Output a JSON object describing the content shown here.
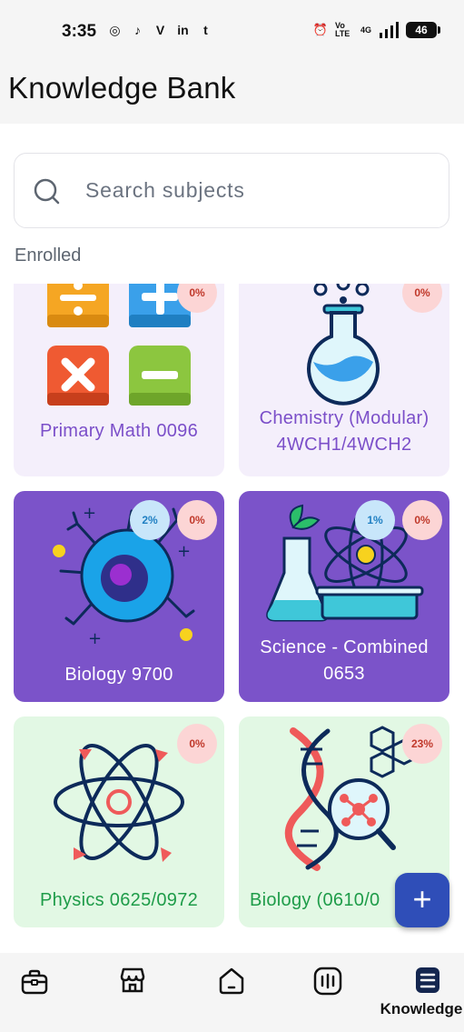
{
  "status_bar": {
    "time": "3:35",
    "app_icons": [
      "instagram-icon",
      "tiktok-icon",
      "v-icon",
      "linkedin-icon",
      "tumblr-icon"
    ],
    "app_glyphs": [
      "◎",
      "♪",
      "V",
      "in",
      "t"
    ],
    "network": "Vo LTE",
    "signal": "4G",
    "battery": "46"
  },
  "header": {
    "title": "Knowledge Bank"
  },
  "search": {
    "placeholder": "Search subjects",
    "value": ""
  },
  "section": {
    "label": "Enrolled"
  },
  "cards": [
    {
      "title": "Primary Math 0096",
      "progress": "0%",
      "icon": "math-operators-icon",
      "bg": "#f4effb",
      "title_color": "#7b4fc9"
    },
    {
      "title_line1": "Chemistry (Modular)",
      "title_line2": "4WCH1/4WCH2",
      "progress": "0%",
      "icon": "flask-icon",
      "bg": "#f4effb",
      "title_color": "#7b4fc9"
    },
    {
      "title": "Biology 9700",
      "progress": "0%",
      "progress_secondary": "2%",
      "icon": "neuron-icon",
      "bg": "#7b53c9",
      "title_color": "#ffffff"
    },
    {
      "title_line1": "Science - Combined",
      "title_line2": "0653",
      "progress": "0%",
      "progress_secondary": "1%",
      "icon": "lab-atom-icon",
      "bg": "#7b53c9",
      "title_color": "#ffffff"
    },
    {
      "title": "Physics 0625/0972",
      "progress": "0%",
      "icon": "atom-icon",
      "bg": "#e2f8e4",
      "title_color": "#1e9c49"
    },
    {
      "title": "Biology (0610/0",
      "progress": "23%",
      "icon": "dna-icon",
      "bg": "#e2f8e4",
      "title_color": "#1e9c49"
    }
  ],
  "fab": {
    "label": "+"
  },
  "bottom_nav": {
    "items": [
      {
        "name": "briefcase-icon",
        "label": ""
      },
      {
        "name": "store-icon",
        "label": ""
      },
      {
        "name": "home-icon",
        "label": ""
      },
      {
        "name": "chart-icon",
        "label": ""
      },
      {
        "name": "knowledge-icon",
        "label": "Knowledge"
      }
    ],
    "active_index": 4
  },
  "colors": {
    "purple": "#7b53c9",
    "green_text": "#1e9c49",
    "fab": "#2f4eb8"
  }
}
